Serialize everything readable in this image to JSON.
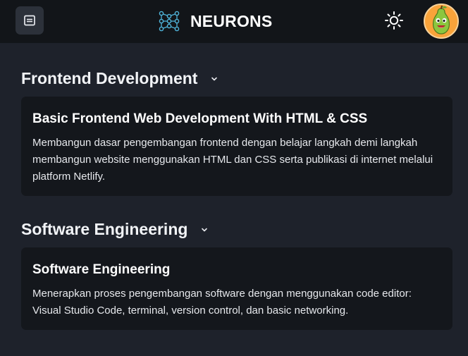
{
  "header": {
    "title": "NEURONS",
    "menu_icon": "menu-icon",
    "logo_icon": "neuron-network-icon",
    "theme_icon": "sun-icon",
    "avatar_icon": "pear-avatar-icon"
  },
  "sections": [
    {
      "title": "Frontend Development",
      "courses": [
        {
          "title": "Basic Frontend Web Development With HTML & CSS",
          "description": "Membangun dasar pengembangan frontend dengan belajar langkah demi langkah membangun website menggunakan HTML dan CSS serta publikasi di internet melalui platform Netlify."
        }
      ]
    },
    {
      "title": "Software Engineering",
      "courses": [
        {
          "title": "Software Engineering",
          "description": "Menerapkan proses pengembangan software dengan menggunakan code editor: Visual Studio Code, terminal, version control, dan basic networking."
        }
      ]
    }
  ],
  "colors": {
    "page_background": "#1e222b",
    "header_background": "#121519",
    "card_background": "#14171c",
    "logo_accent": "#4fb3d9",
    "avatar_background": "#f9a33a"
  }
}
